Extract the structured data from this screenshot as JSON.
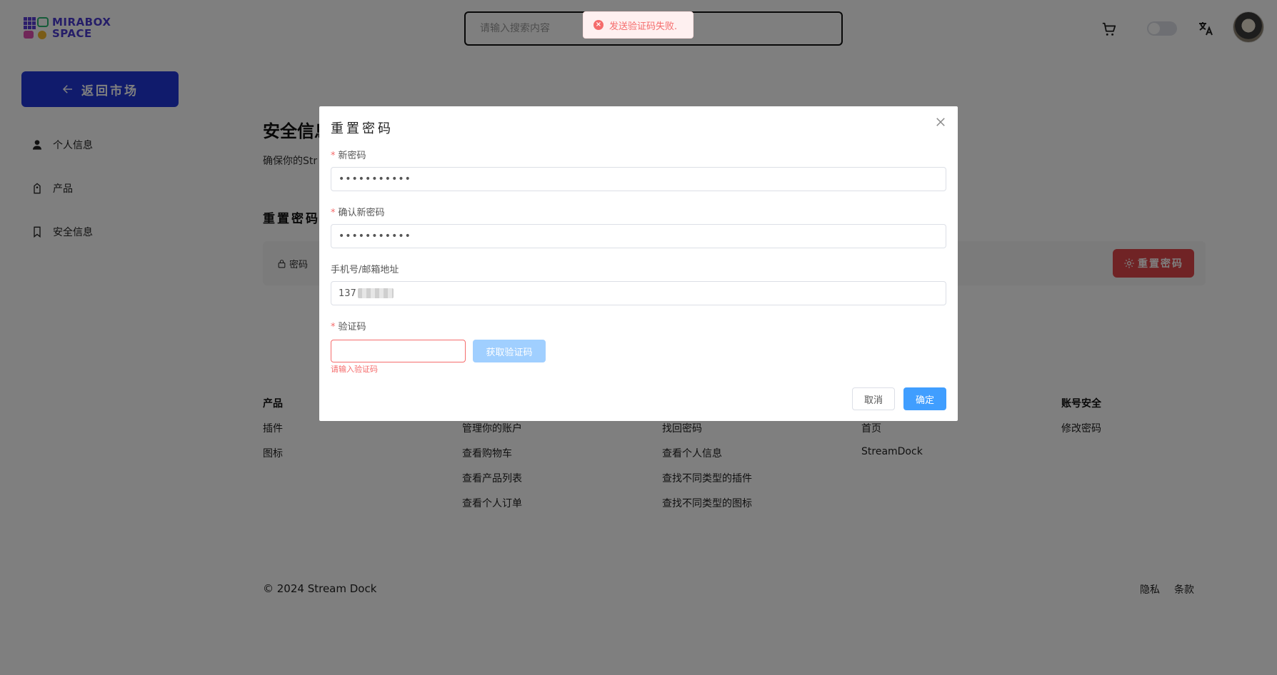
{
  "header": {
    "logo_line1": "MIRABOX",
    "logo_line2": "SPACE",
    "search_placeholder": "请输入搜索内容"
  },
  "sidebar": {
    "back_label": "返回市场",
    "items": [
      {
        "label": "个人信息",
        "icon": "user-icon"
      },
      {
        "label": "产品",
        "icon": "tag-icon"
      },
      {
        "label": "安全信息",
        "icon": "bookmark-icon"
      }
    ]
  },
  "main": {
    "title": "安全信息",
    "description": "确保你的Str",
    "section_title": "重置密码",
    "password_label": "密码",
    "reset_button": "重置密码"
  },
  "footer": {
    "columns": [
      {
        "head": "产品",
        "links": [
          "插件",
          "图标"
        ]
      },
      {
        "head": "",
        "links": [
          "管理你的账户",
          "查看购物车",
          "查看产品列表",
          "查看个人订单"
        ]
      },
      {
        "head": "",
        "links": [
          "找回密码",
          "查看个人信息",
          "查找不同类型的插件",
          "查找不同类型的图标"
        ]
      },
      {
        "head": "",
        "links": [
          "首页",
          "StreamDock"
        ]
      },
      {
        "head": "账号安全",
        "links": [
          "修改密码"
        ]
      }
    ],
    "copyright": "© 2024 Stream Dock",
    "privacy": "隐私",
    "terms": "条款"
  },
  "dialog": {
    "title": "重置密码",
    "new_password_label": "新密码",
    "new_password_value": "•••••••••••",
    "confirm_password_label": "确认新密码",
    "confirm_password_value": "•••••••••••",
    "contact_label": "手机号/邮箱地址",
    "contact_value": "137",
    "code_label": "验证码",
    "code_button": "获取验证码",
    "code_error": "请输入验证码",
    "cancel": "取消",
    "confirm": "确定"
  },
  "toast": {
    "message": "发送验证码失败."
  },
  "colors": {
    "primary_blue": "#2037d8",
    "danger_red": "#e0464a",
    "element_blue": "#409eff",
    "element_red": "#f56c6c"
  }
}
